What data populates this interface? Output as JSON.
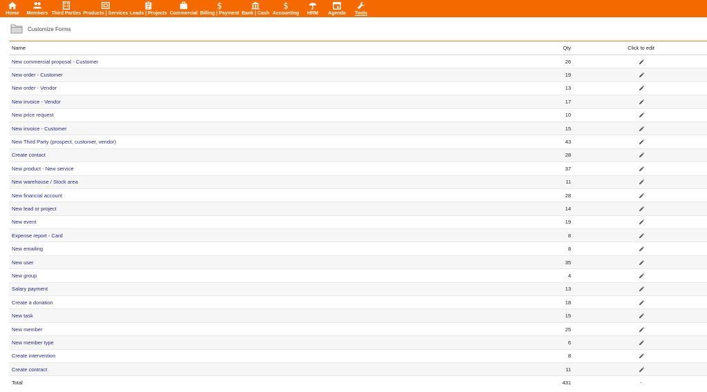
{
  "nav": {
    "items": [
      {
        "label": "Home",
        "icon": "home-icon"
      },
      {
        "label": "Members",
        "icon": "members-icon"
      },
      {
        "label": "Third Parties",
        "icon": "building-icon"
      },
      {
        "label": "Products | Services",
        "icon": "product-box-icon"
      },
      {
        "label": "Leads | Projects",
        "icon": "clipboard-icon"
      },
      {
        "label": "Commercial",
        "icon": "briefcase-icon"
      },
      {
        "label": "Billing | Payment",
        "icon": "dollar-icon"
      },
      {
        "label": "Bank | Cash",
        "icon": "bank-icon"
      },
      {
        "label": "Accounting",
        "icon": "dollar-icon"
      },
      {
        "label": "HRM",
        "icon": "umbrella-icon"
      },
      {
        "label": "Agenda",
        "icon": "calendar-icon"
      },
      {
        "label": "Tools",
        "icon": "wrench-icon",
        "active": true
      }
    ],
    "bar_color": "#f56a00"
  },
  "header": {
    "title": "Customize Forms",
    "icon": "folder-icon"
  },
  "table": {
    "columns": {
      "name": "Name",
      "qty": "Qty",
      "edit": "Click to edit"
    },
    "rows": [
      {
        "name": "New commercial proposal - Customer",
        "qty": "26"
      },
      {
        "name": "New order - Customer",
        "qty": "19"
      },
      {
        "name": "New order - Vendor",
        "qty": "13"
      },
      {
        "name": "New invoice - Vendor",
        "qty": "17"
      },
      {
        "name": "New price request",
        "qty": "10"
      },
      {
        "name": "New invoice - Customer",
        "qty": "15"
      },
      {
        "name": "New Third Party (prospect, customer, vendor)",
        "qty": "43"
      },
      {
        "name": "Create contact",
        "qty": "28"
      },
      {
        "name": "New product - New service",
        "qty": "37"
      },
      {
        "name": "New warehouse / Stock area",
        "qty": "11"
      },
      {
        "name": "New financial account",
        "qty": "28"
      },
      {
        "name": "New lead or project",
        "qty": "14"
      },
      {
        "name": "New event",
        "qty": "19"
      },
      {
        "name": "Expense report - Card",
        "qty": "8"
      },
      {
        "name": "New emailing",
        "qty": "8"
      },
      {
        "name": "New user",
        "qty": "35"
      },
      {
        "name": "New group",
        "qty": "4"
      },
      {
        "name": "Salary payment",
        "qty": "13"
      },
      {
        "name": "Create a donation",
        "qty": "18"
      },
      {
        "name": "New task",
        "qty": "15"
      },
      {
        "name": "New member",
        "qty": "25"
      },
      {
        "name": "New member type",
        "qty": "6"
      },
      {
        "name": "Create intervention",
        "qty": "8"
      },
      {
        "name": "Create contract",
        "qty": "11"
      }
    ],
    "edit_icon": "pencil-icon",
    "total": {
      "label": "Total",
      "qty": "431",
      "edit": "-"
    }
  }
}
